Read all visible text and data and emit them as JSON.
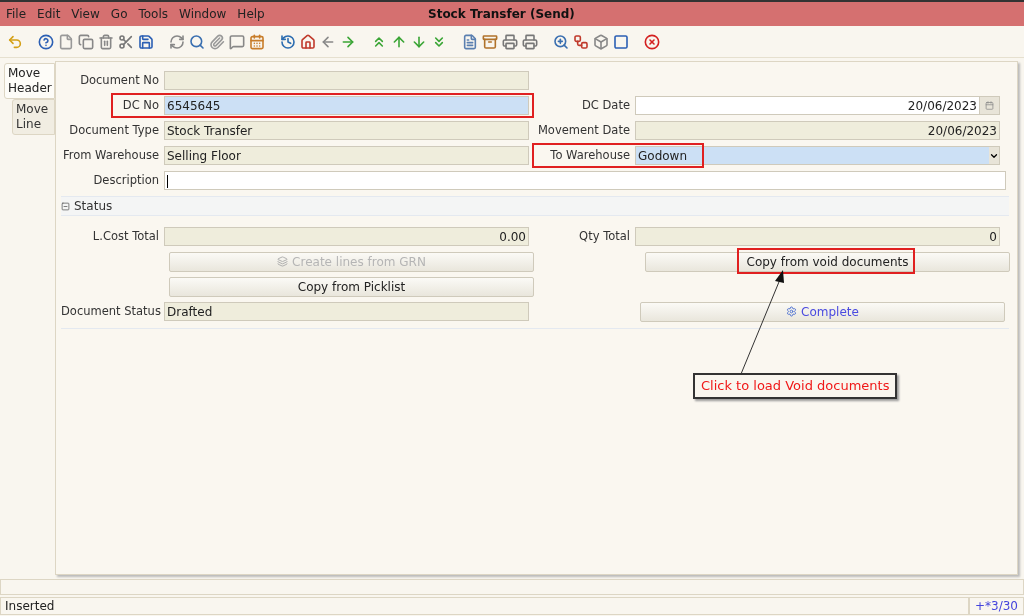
{
  "window": {
    "title": "Stock Transfer (Send)"
  },
  "menu": [
    "File",
    "Edit",
    "View",
    "Go",
    "Tools",
    "Window",
    "Help"
  ],
  "tabs": [
    {
      "label": "Move Header",
      "selected": true
    },
    {
      "label": "Move Line",
      "selected": false
    }
  ],
  "form": {
    "rows": [
      {
        "left": {
          "kind": "readonly",
          "label": "Document No"
        }
      },
      {
        "left": {
          "kind": "text",
          "label": "DC No",
          "value": "6545645",
          "highlighted": true,
          "annotated": true
        },
        "right": {
          "kind": "date",
          "label": "DC Date",
          "value": "20/06/2023",
          "highlighted": false,
          "annotated": false
        }
      },
      {
        "left": {
          "kind": "readonly",
          "label": "Document Type",
          "value": "Stock Transfer"
        },
        "right": {
          "kind": "readonly-number",
          "label": "Movement Date",
          "value": "20/06/2023"
        }
      },
      {
        "left": {
          "kind": "readonly",
          "label": "From Warehouse",
          "value": "Selling Floor"
        },
        "right": {
          "kind": "combo",
          "label": "To Warehouse",
          "value": "Godown",
          "highlighted": true,
          "annotated": true
        }
      },
      {
        "wide": {
          "kind": "text",
          "label": "Description",
          "highlighted": false,
          "annotated": false
        }
      }
    ]
  },
  "status_section": {
    "title": "Status",
    "expanded": true,
    "rows": [
      {
        "left": {
          "kind": "readonly-number",
          "label": "L.Cost Total",
          "value": "0.00"
        },
        "right": {
          "kind": "readonly-number",
          "label": "Qty Total",
          "value": "0"
        }
      },
      {
        "left": {
          "kind": "button",
          "label": "Create lines from GRN",
          "disabled": true,
          "icon": true,
          "annotated": false
        },
        "right": {
          "kind": "button",
          "label": "Copy from void documents",
          "disabled": false,
          "icon": false,
          "annotated": true
        }
      },
      {
        "left": {
          "kind": "button",
          "label": "Copy from Picklist",
          "disabled": false,
          "icon": false,
          "annotated": false
        }
      },
      {
        "left": {
          "kind": "readonly",
          "label": "Document Status",
          "value": "Drafted"
        },
        "right": {
          "kind": "button",
          "label": "Complete",
          "disabled": false,
          "icon": true,
          "process": true,
          "annotated": false
        }
      }
    ]
  },
  "callout": {
    "text": "Click to load Void documents"
  },
  "status_bar": {
    "message": "Inserted",
    "record": "+*3/30"
  }
}
